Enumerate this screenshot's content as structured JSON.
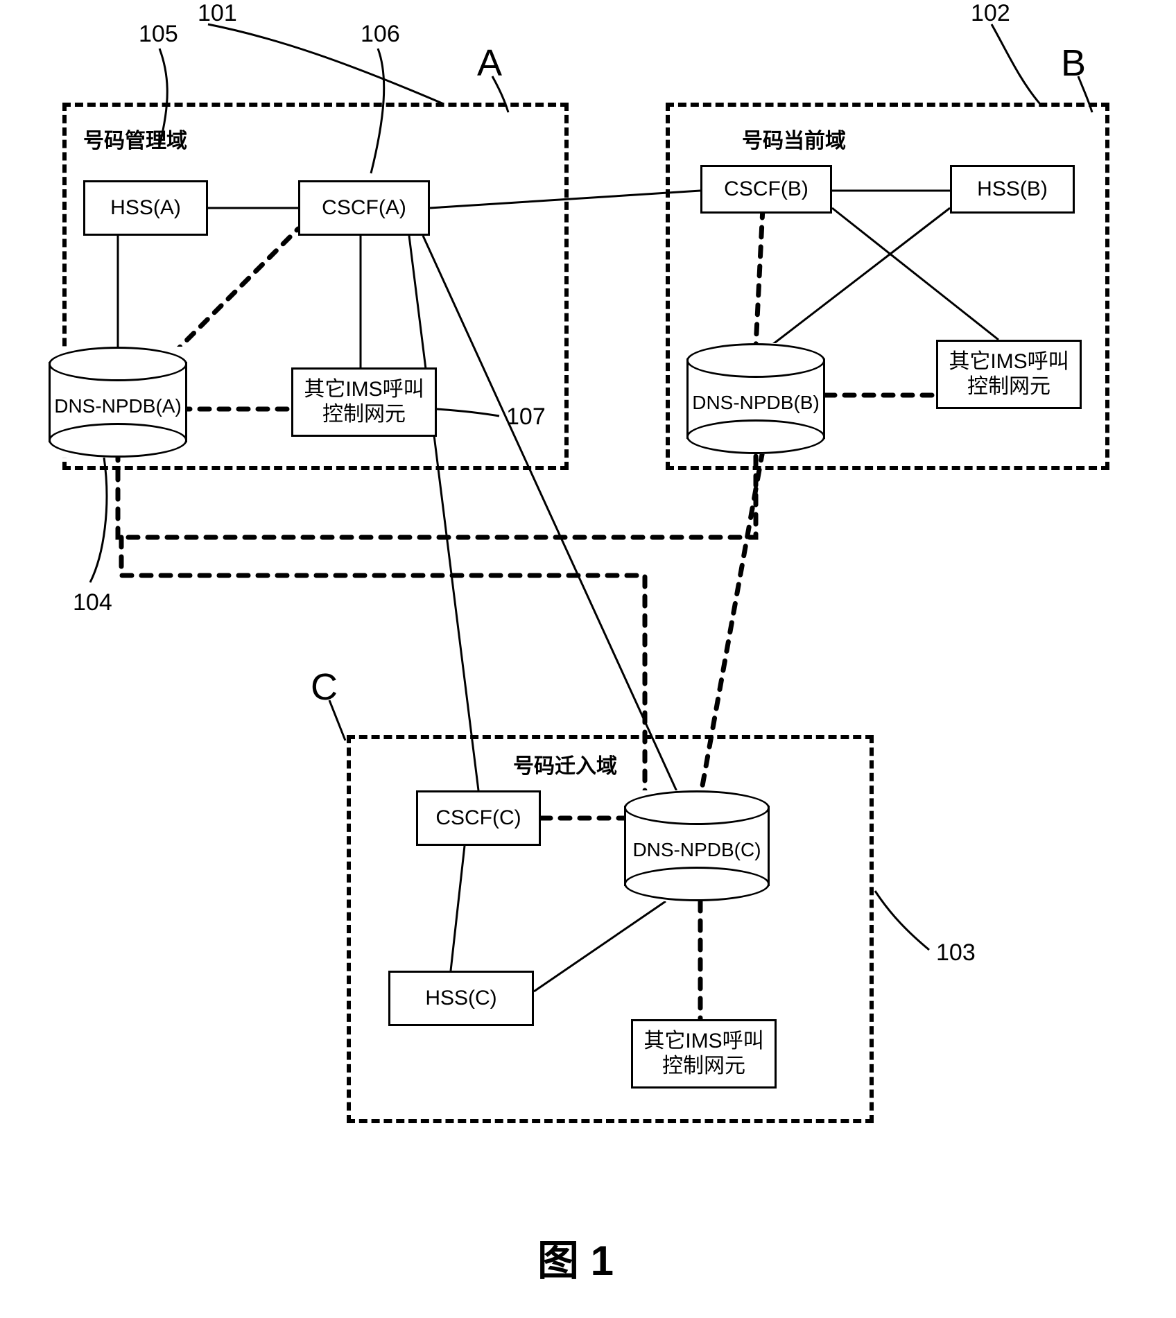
{
  "figure_caption": "图 1",
  "domains": {
    "A": {
      "letter": "A",
      "title": "号码管理域",
      "ref": "101"
    },
    "B": {
      "letter": "B",
      "title": "号码当前域",
      "ref": "102"
    },
    "C": {
      "letter": "C",
      "title": "号码迁入域",
      "ref": "103"
    }
  },
  "nodes": {
    "hssA": {
      "label": "HSS(A)",
      "ref": "105"
    },
    "cscfA": {
      "label": "CSCF(A)",
      "ref": "106"
    },
    "npdbA": {
      "label": "DNS-NPDB(A)",
      "ref": "104"
    },
    "otherA": {
      "label": "其它IMS呼叫控制网元",
      "ref": "107"
    },
    "hssB": {
      "label": "HSS(B)"
    },
    "cscfB": {
      "label": "CSCF(B)"
    },
    "npdbB": {
      "label": "DNS-NPDB(B)"
    },
    "otherB": {
      "label": "其它IMS呼叫控制网元"
    },
    "hssC": {
      "label": "HSS(C)"
    },
    "cscfC": {
      "label": "CSCF(C)"
    },
    "npdbC": {
      "label": "DNS-NPDB(C)"
    },
    "otherC": {
      "label": "其它IMS呼叫控制网元"
    }
  },
  "edges_solid": [
    [
      "hssA",
      "cscfA"
    ],
    [
      "hssA",
      "npdbA"
    ],
    [
      "cscfA",
      "otherA"
    ],
    [
      "cscfA",
      "cscfB"
    ],
    [
      "cscfA",
      "cscfC"
    ],
    [
      "cscfA",
      "npdbC"
    ],
    [
      "cscfB",
      "hssB"
    ],
    [
      "cscfB",
      "npdbB"
    ],
    [
      "hssB",
      "npdbB"
    ],
    [
      "cscfC",
      "hssC"
    ],
    [
      "hssC",
      "npdbC"
    ]
  ],
  "edges_dotted": [
    [
      "npdbA",
      "cscfA"
    ],
    [
      "npdbA",
      "otherA"
    ],
    [
      "npdbA",
      "npdbB"
    ],
    [
      "npdbA",
      "npdbC"
    ],
    [
      "cscfB",
      "npdbB"
    ],
    [
      "npdbB",
      "otherB"
    ],
    [
      "npdbB",
      "npdbC"
    ],
    [
      "cscfC",
      "npdbC"
    ],
    [
      "npdbC",
      "otherC"
    ]
  ]
}
